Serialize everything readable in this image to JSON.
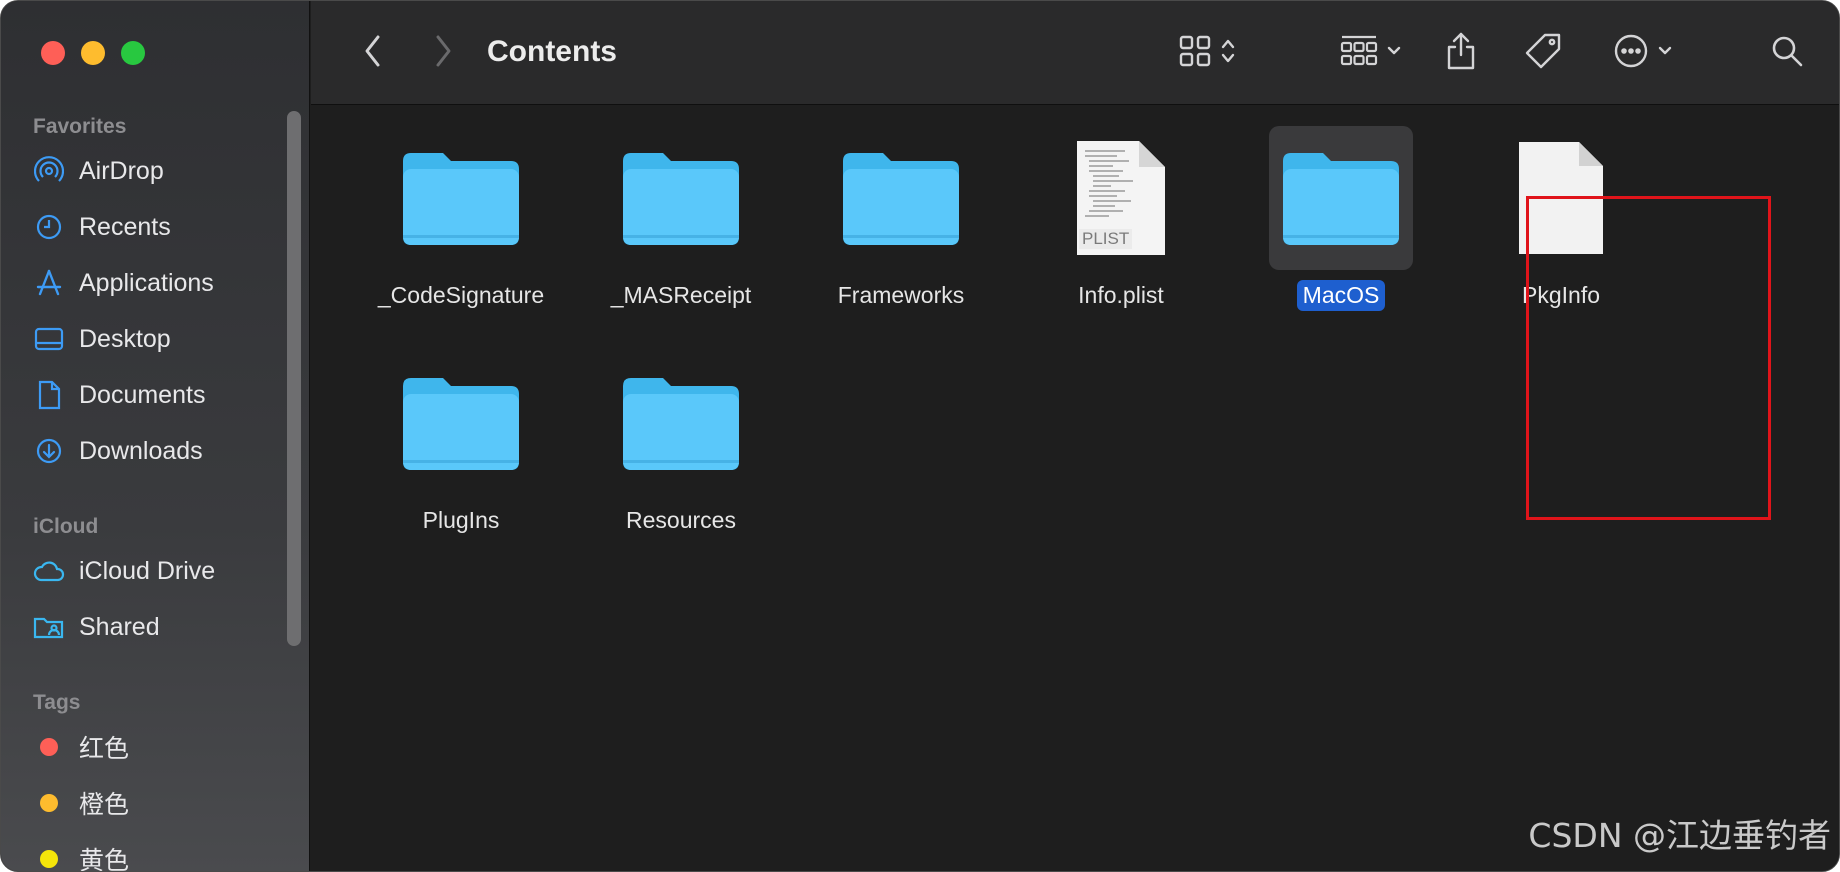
{
  "window": {
    "title": "Contents"
  },
  "sidebar": {
    "sections": {
      "favorites": "Favorites",
      "icloud": "iCloud",
      "tags": "Tags"
    },
    "favorites": [
      {
        "label": "AirDrop",
        "icon": "airdrop-icon"
      },
      {
        "label": "Recents",
        "icon": "clock-icon"
      },
      {
        "label": "Applications",
        "icon": "applications-icon"
      },
      {
        "label": "Desktop",
        "icon": "desktop-icon"
      },
      {
        "label": "Documents",
        "icon": "document-icon"
      },
      {
        "label": "Downloads",
        "icon": "download-icon"
      }
    ],
    "icloud": [
      {
        "label": "iCloud Drive",
        "icon": "cloud-icon"
      },
      {
        "label": "Shared",
        "icon": "shared-folder-icon"
      }
    ],
    "tags": [
      {
        "label": "红色",
        "color": "#fe5f57"
      },
      {
        "label": "橙色",
        "color": "#febc2e"
      },
      {
        "label": "黄色",
        "color": "#f5e50a"
      }
    ]
  },
  "files": [
    {
      "label": "_CodeSignature",
      "kind": "folder"
    },
    {
      "label": "_MASReceipt",
      "kind": "folder"
    },
    {
      "label": "Frameworks",
      "kind": "folder"
    },
    {
      "label": "Info.plist",
      "kind": "plist",
      "badge": "PLIST"
    },
    {
      "label": "MacOS",
      "kind": "folder",
      "selected": true
    },
    {
      "label": "PkgInfo",
      "kind": "document"
    },
    {
      "label": "PlugIns",
      "kind": "folder"
    },
    {
      "label": "Resources",
      "kind": "folder"
    }
  ],
  "watermark": "CSDN @江边垂钓者",
  "colors": {
    "folder": "#5ac8fa",
    "folder_tab": "#3fb6ec",
    "selection": "#1e5fcf",
    "annotation": "#e0141a"
  }
}
